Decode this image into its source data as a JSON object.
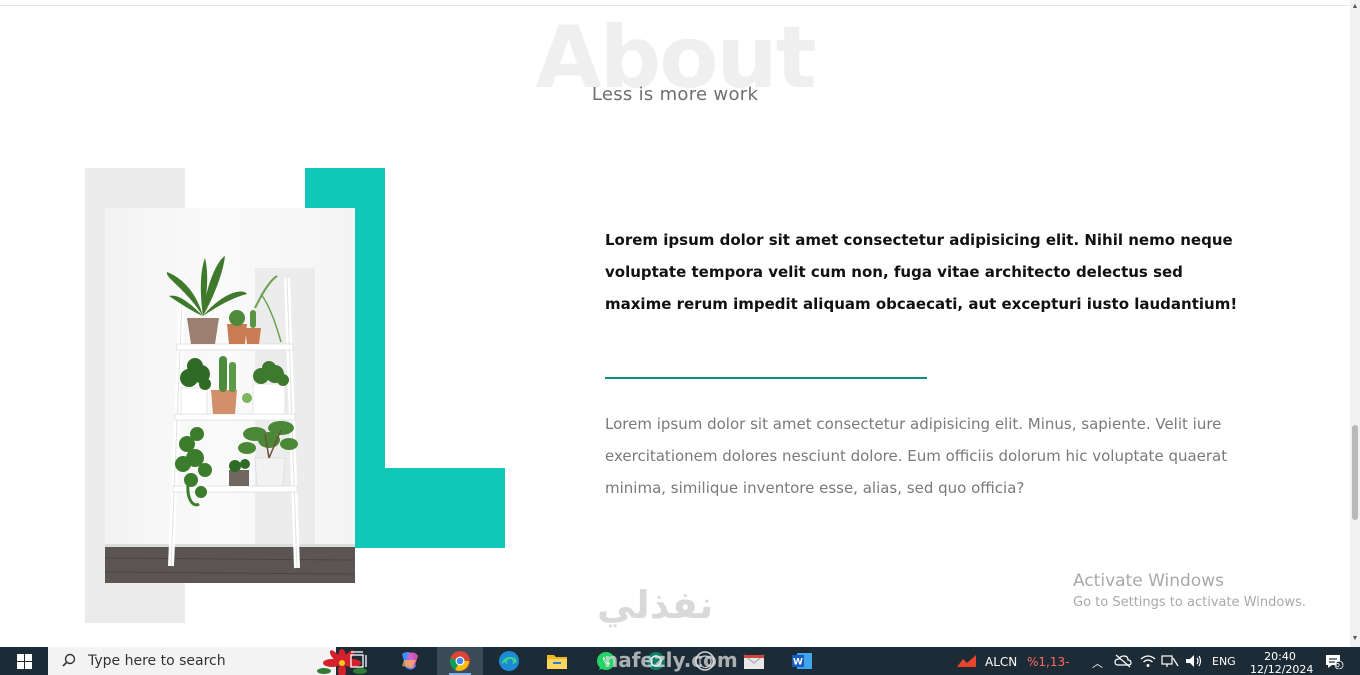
{
  "header": {
    "background_title": "About",
    "subtitle": "Less is more work"
  },
  "content": {
    "lead": "Lorem ipsum dolor sit amet consectetur adipisicing elit. Nihil nemo neque voluptate tempora velit cum non, fuga vitae architecto delectus sed maxime rerum impedit aliquam obcaecati, aut excepturi iusto laudantium!",
    "body": "Lorem ipsum dolor sit amet consectetur adipisicing elit. Minus, sapiente. Velit iure exercitationem dolores nesciunt dolore. Eum officiis dolorum hic voluptate quaerat minima, similique inventore esse, alias, sed quo officia?"
  },
  "colors": {
    "accent": "#11c8b8",
    "divider": "#0e8f84",
    "taskbar": "#1c2b36"
  },
  "watermark": {
    "activate_title": "Activate Windows",
    "activate_sub": "Go to Settings to activate Windows.",
    "site_ar": "نفذلي",
    "site_en": "nafezly.com"
  },
  "taskbar": {
    "search_placeholder": "Type here to search",
    "icons": [
      "windows-start-icon",
      "search-icon",
      "poinsettia-icon",
      "task-view-icon",
      "copilot-icon",
      "chrome-icon",
      "edge-icon",
      "file-explorer-icon",
      "whatsapp-icon",
      "chatgpt-icon",
      "mail-icon",
      "word-icon"
    ],
    "stock_symbol": "ALCN",
    "stock_change": "%1,13-",
    "language": "ENG",
    "time": "20:40",
    "date": "12/12/2024",
    "notification_count": "6"
  }
}
